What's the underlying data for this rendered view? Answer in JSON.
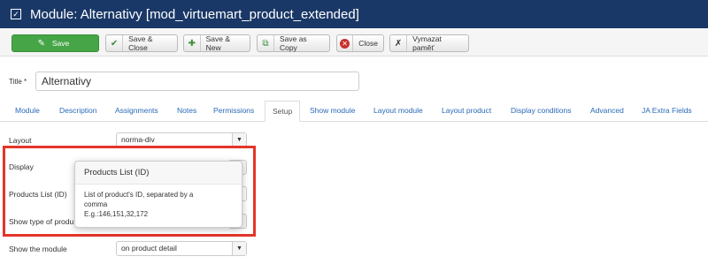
{
  "header": {
    "title": "Module: Alternativy [mod_virtuemart_product_extended]"
  },
  "toolbar": {
    "save": "Save",
    "save_close": "Save & Close",
    "save_new": "Save & New",
    "save_copy": "Save as Copy",
    "close": "Close",
    "clear_cache": "Vymazat paměť"
  },
  "title_field": {
    "label": "Title *",
    "value": "Alternativy"
  },
  "tabs": [
    "Module",
    "Description",
    "Assignments",
    "Notes",
    "Permissions",
    "Setup",
    "Show module",
    "Layout module",
    "Layout product",
    "Display conditions",
    "Advanced",
    "JA Extra Fields"
  ],
  "fields": {
    "layout": {
      "label": "Layout",
      "value": "norma-div"
    },
    "display": {
      "label": "Display"
    },
    "products_list": {
      "label": "Products List (ID)"
    },
    "show_type": {
      "label": "Show type of produ"
    },
    "show_module": {
      "label": "Show the module",
      "value": "on product detail"
    }
  },
  "popover": {
    "title": "Products List (ID)",
    "line1": "List of product's ID, separated by a",
    "line2": "comma",
    "line3": "E.g.:146,151,32,172"
  },
  "colors": {
    "header_bg": "#1a3867",
    "save_green": "#46a546",
    "highlight_red": "#e3362a",
    "link_blue": "#2a69b8"
  }
}
